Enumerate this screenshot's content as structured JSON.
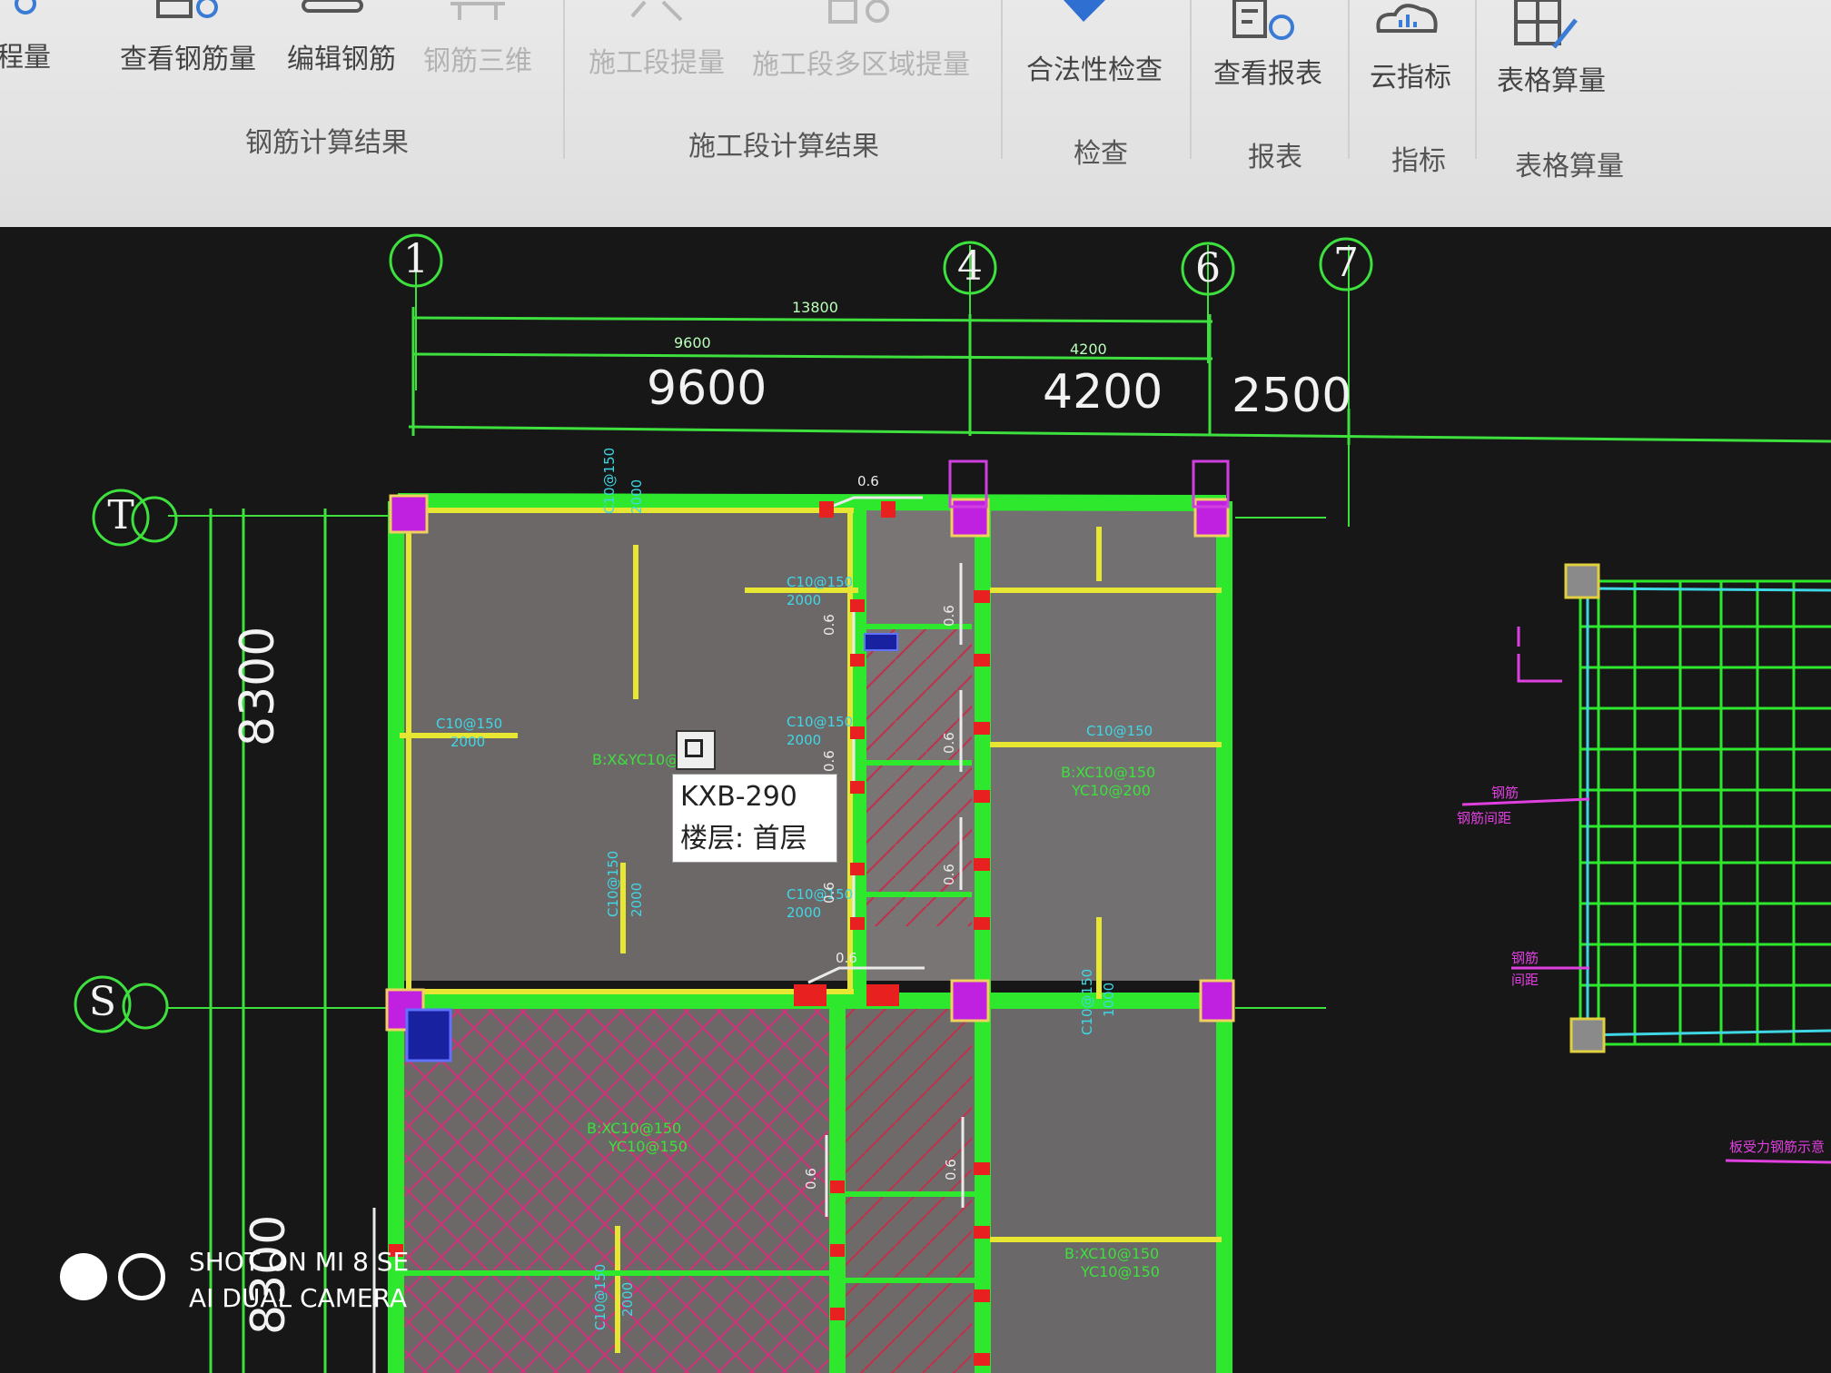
{
  "ribbon": {
    "buttons": [
      {
        "id": "project-quantity",
        "label": "工程量",
        "disabled": false
      },
      {
        "id": "view-rebar",
        "label": "查看钢筋量",
        "disabled": false
      },
      {
        "id": "edit-rebar",
        "label": "编辑钢筋",
        "disabled": false
      },
      {
        "id": "rebar-3d",
        "label": "钢筋三维",
        "disabled": true
      },
      {
        "id": "stage-extract",
        "label": "施工段提量",
        "disabled": true
      },
      {
        "id": "stage-multi",
        "label": "施工段多区域提量",
        "disabled": true
      },
      {
        "id": "legality-check",
        "label": "合法性检查",
        "disabled": false
      },
      {
        "id": "view-report",
        "label": "查看报表",
        "disabled": false
      },
      {
        "id": "cloud-index",
        "label": "云指标",
        "disabled": false
      },
      {
        "id": "table-calc",
        "label": "表格算量",
        "disabled": false
      }
    ],
    "groups": {
      "rebar_result": "钢筋计算结果",
      "stage_result": "施工段计算结果",
      "check": "检查",
      "report": "报表",
      "index": "指标",
      "table_calc": "表格算量"
    }
  },
  "drawing": {
    "axes_top": [
      "1",
      "4",
      "6",
      "7"
    ],
    "axes_left": [
      "T",
      "S"
    ],
    "dims_big": [
      "9600",
      "4200",
      "2500",
      "8300",
      "8300"
    ],
    "dims_small": [
      "13800",
      "9600",
      "4200"
    ],
    "colors": {
      "wall_green": "#2ee82e",
      "beam_yellow": "#e6e633",
      "column_magenta": "#c020e0",
      "hatch_pink": "#d0307a",
      "slab_gray": "#6e6a6a",
      "text_cyan": "#3fd7e6",
      "marker_red": "#e82020"
    }
  },
  "tooltip": {
    "line1": "KXB-290",
    "line2": "楼层: 首层"
  },
  "watermark": {
    "line1": "SHOT ON MI 8 SE",
    "line2": "AI DUAL CAMERA"
  }
}
